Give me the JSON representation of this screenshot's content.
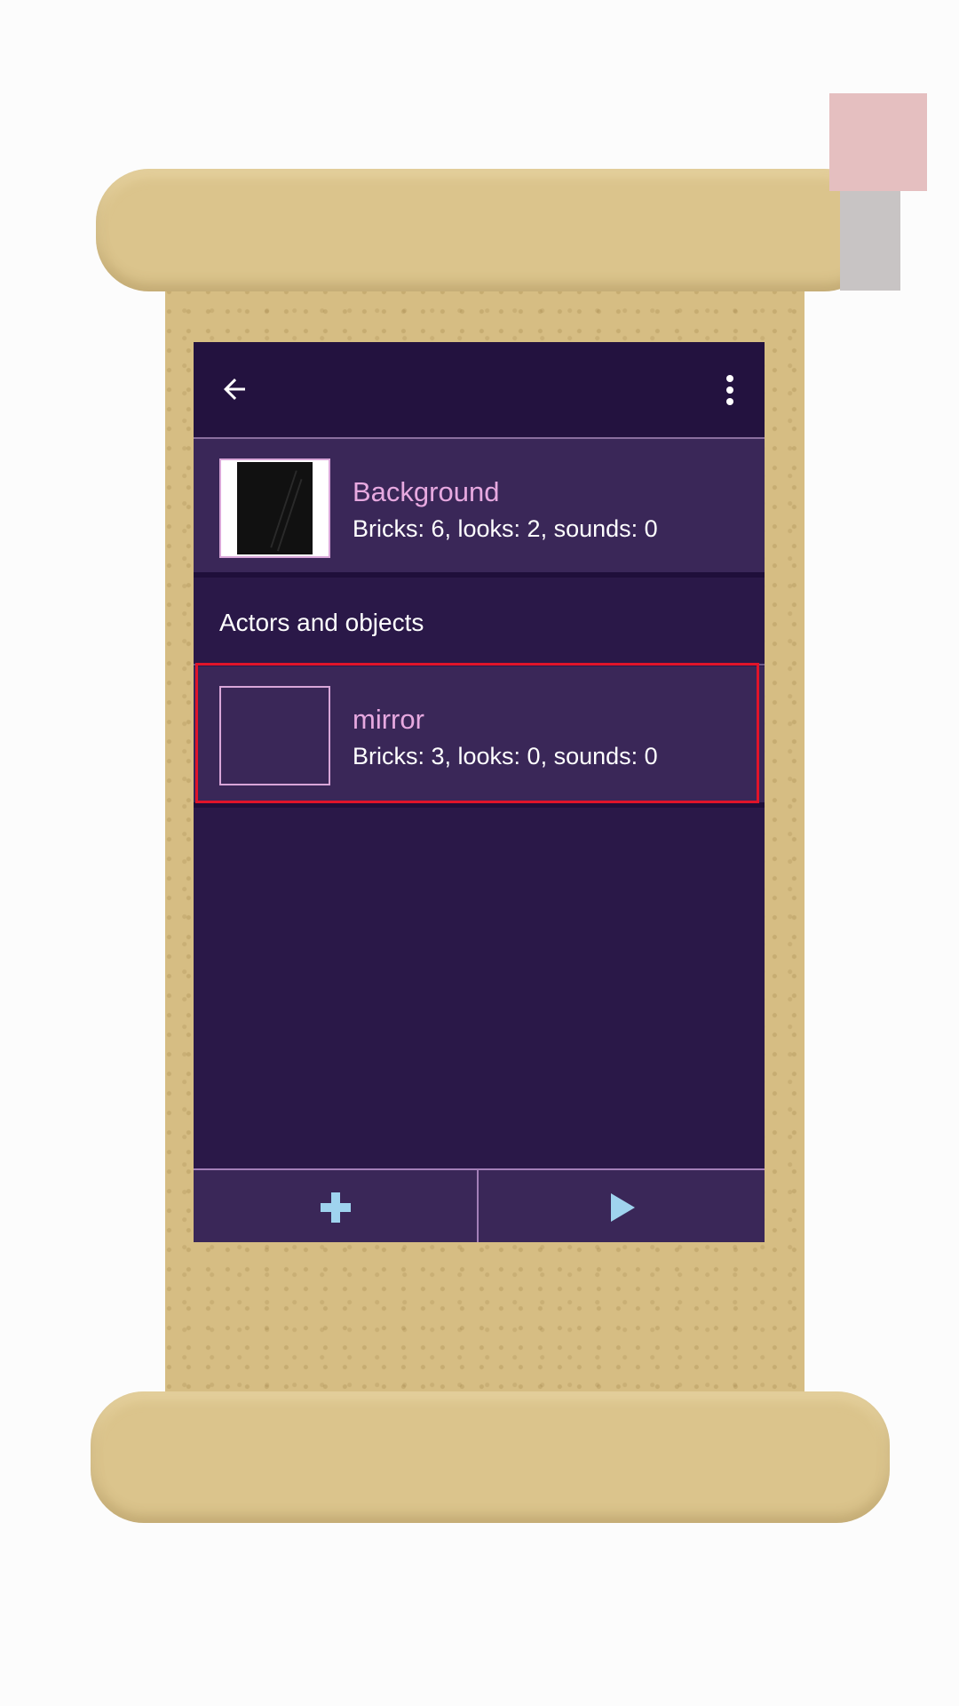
{
  "app_bar": {
    "title": "",
    "back_icon": "arrow-left-icon",
    "menu_icon": "more-vertical-icon"
  },
  "background_sprite": {
    "name": "Background",
    "details": "Bricks: 6, looks: 2, sounds: 0"
  },
  "section": {
    "title": "Actors and objects"
  },
  "sprites": [
    {
      "name": "mirror",
      "details": "Bricks: 3, looks: 0, sounds: 0"
    }
  ],
  "bottom_bar": {
    "add_icon": "plus-icon",
    "play_icon": "play-icon"
  },
  "colors": {
    "accent": "#e7a9e0",
    "background": "#2a1848",
    "row": "#3a2758",
    "icon": "#9fd3ee",
    "highlight": "#e0142a"
  }
}
